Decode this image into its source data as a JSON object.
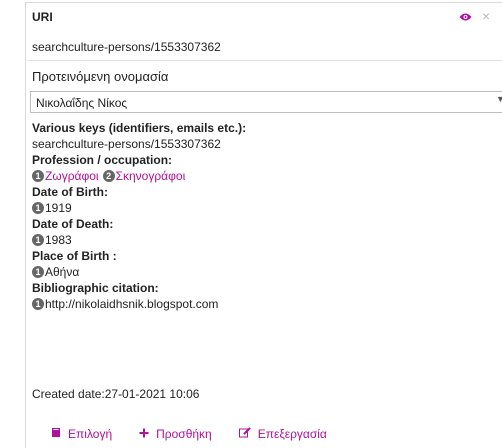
{
  "header": {
    "title": "URI"
  },
  "uri_value": "searchculture-persons/1553307362",
  "proposed_name": {
    "label": "Προτεινόμενη ονομασία",
    "selected": "Νικολαΐδης Νίκος"
  },
  "fields": {
    "keys_label": "Various keys (identifiers, emails etc.):",
    "keys_value": "searchculture-persons/1553307362",
    "profession_label": "Profession / occupation:",
    "professions": [
      {
        "badge": "1",
        "text": "Ζωγράφοι"
      },
      {
        "badge": "2",
        "text": "Σκηνογράφοι"
      }
    ],
    "dob_label": "Date of Birth:",
    "dob": {
      "badge": "1",
      "text": "1919"
    },
    "dod_label": "Date of Death:",
    "dod": {
      "badge": "1",
      "text": "1983"
    },
    "pob_label": "Place of Birth :",
    "pob": {
      "badge": "1",
      "text": "Αθήνα"
    },
    "biblio_label": "Bibliographic citation:",
    "biblio": {
      "badge": "1",
      "text": "http://nikolaidhsnik.blogspot.com"
    }
  },
  "created": "Created date:27-01-2021 10:06",
  "actions": {
    "select_label": "Επιλογή",
    "add_label": "Προσθήκη",
    "edit_label": "Επεξεργασία"
  },
  "icons": {
    "eye": "eye-icon",
    "close": "close-icon",
    "select": "book-icon",
    "add": "plus-icon",
    "edit": "edit-icon"
  },
  "colors": {
    "accent": "#b0109a",
    "badge": "#666666"
  }
}
